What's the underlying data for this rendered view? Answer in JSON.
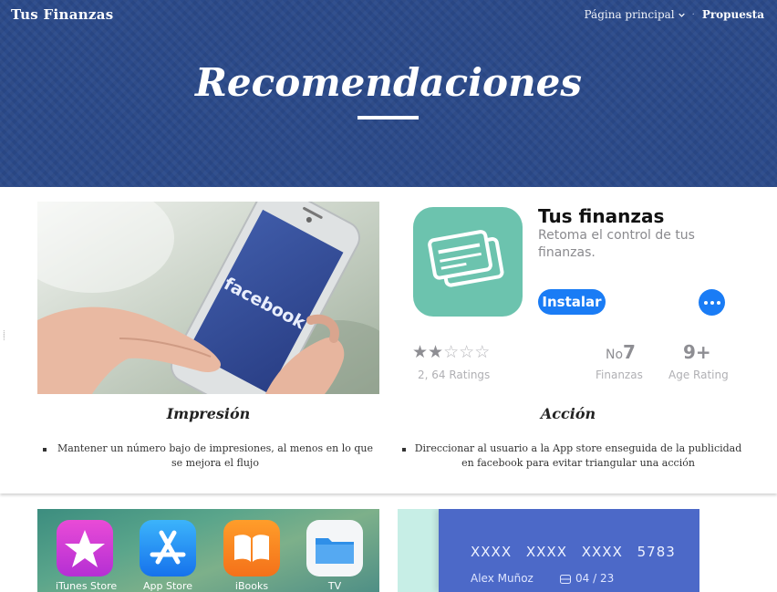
{
  "header": {
    "brand": "Tus Finanzas",
    "nav": {
      "home_label": "Página principal",
      "separator": "·",
      "proposal_label": "Propuesta"
    },
    "title": "Recomendaciones",
    "background_color": "#2b4a8a"
  },
  "impression": {
    "title": "Impresión",
    "bullet": "Mantener un número bajo de impresiones, al menos en lo que se mejora el flujo"
  },
  "action": {
    "title": "Acción",
    "bullet": "Direccionar al usuario a la App store enseguida de la publicidad en facebook para evitar triangular una acción"
  },
  "photo": {
    "phone_app_text": "facebook"
  },
  "app_store": {
    "app_name": "Tus finanzas",
    "subtitle": "Retoma el control de tus finanzas.",
    "install_label": "Instalar",
    "rating_stars": 2,
    "rating_max": 5,
    "ratings_count": "2, 64 Ratings",
    "rank_prefix": "No",
    "rank_value": "7",
    "rank_category": "Finanzas",
    "age_rating": "9+",
    "age_label": "Age Rating",
    "icon_color": "#6cc3ae",
    "accent_color": "#1a7cf5"
  },
  "ios_apps": [
    {
      "label": "iTunes Store",
      "icon": "star-icon"
    },
    {
      "label": "App Store",
      "icon": "app-store-icon"
    },
    {
      "label": "iBooks",
      "icon": "book-icon"
    },
    {
      "label": "TV",
      "icon": "folder-icon"
    }
  ],
  "credit_card": {
    "number": "XXXX XXXX XXXX 5783",
    "holder": "Alex Muñoz",
    "expiry": "04 / 23",
    "color": "#4c69c8"
  }
}
